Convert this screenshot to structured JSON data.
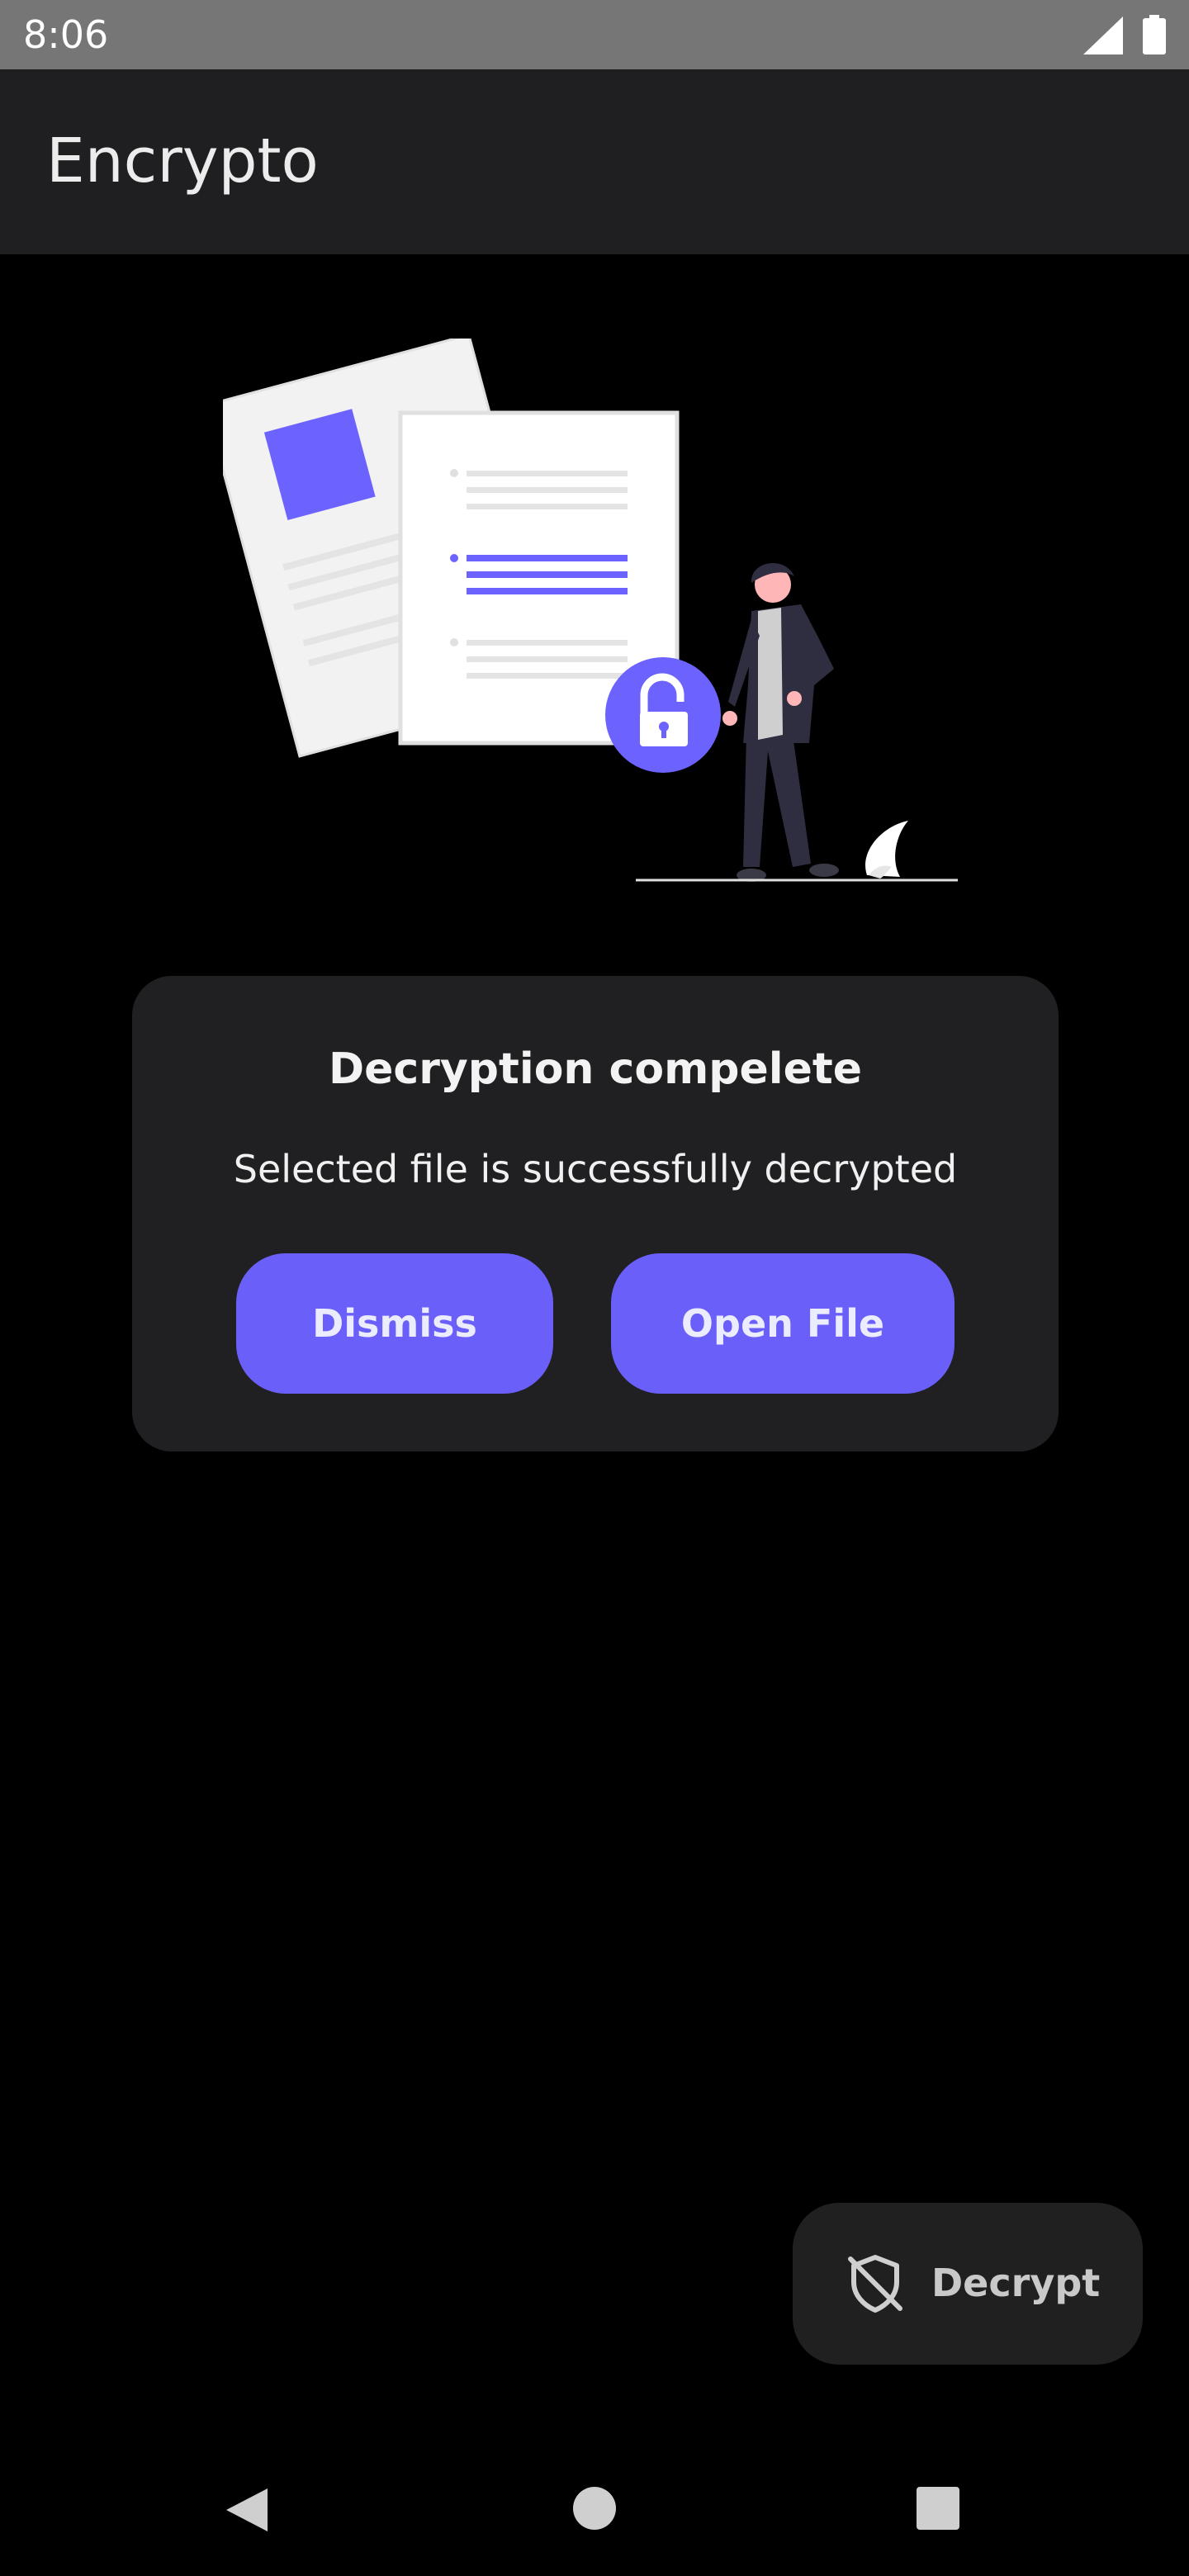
{
  "status_bar": {
    "time": "8:06",
    "signal_icon": "cell-signal-icon",
    "battery_icon": "battery-icon"
  },
  "app_bar": {
    "title": "Encrypto"
  },
  "illustration": {
    "name": "document-unlock-illustration",
    "accent_color": "#6c63ff"
  },
  "dialog": {
    "title": "Decryption compelete",
    "message": "Selected file is successfully decrypted",
    "dismiss_label": "Dismiss",
    "open_label": "Open File"
  },
  "fab": {
    "icon": "shield-off-icon",
    "label": "Decrypt"
  },
  "nav_bar": {
    "back_icon": "back-triangle-icon",
    "home_icon": "home-circle-icon",
    "recents_icon": "recents-square-icon"
  },
  "colors": {
    "background": "#000000",
    "app_bar": "#1f1f22",
    "status_bar": "#767676",
    "card": "#202022",
    "accent": "#6a5ff8",
    "fab": "#202021"
  }
}
